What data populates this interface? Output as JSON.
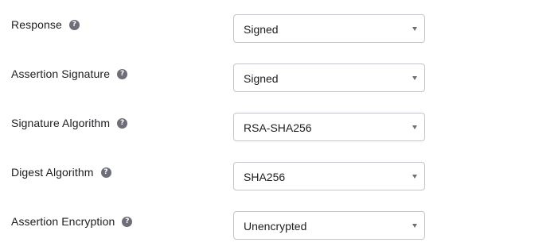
{
  "fields": [
    {
      "label": "Response",
      "value": "Signed",
      "help_icon": "question-circle-icon"
    },
    {
      "label": "Assertion Signature",
      "value": "Signed",
      "help_icon": "question-circle-icon"
    },
    {
      "label": "Signature Algorithm",
      "value": "RSA-SHA256",
      "help_icon": "question-circle-icon"
    },
    {
      "label": "Digest Algorithm",
      "value": "SHA256",
      "help_icon": "question-circle-icon"
    },
    {
      "label": "Assertion Encryption",
      "value": "Unencrypted",
      "help_icon": "question-circle-icon"
    }
  ],
  "help_glyph": "?",
  "colors": {
    "text": "#1d1d21",
    "help_icon_bg": "#6e6e78",
    "select_border": "#c4c4cc",
    "caret": "#6e6e78"
  }
}
